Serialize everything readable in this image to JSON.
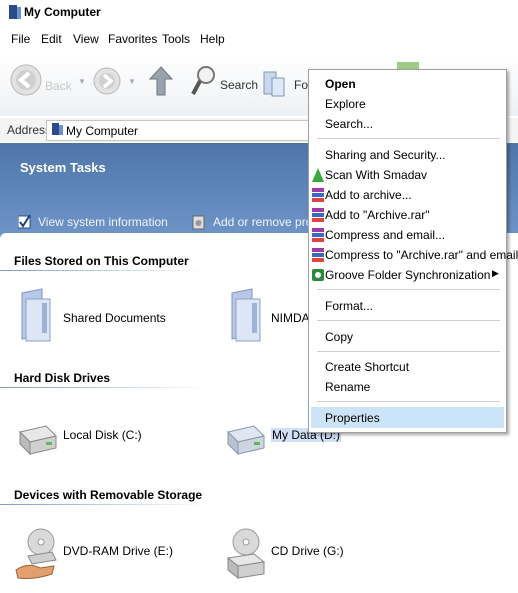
{
  "window": {
    "title": "My Computer"
  },
  "menu": [
    "File",
    "Edit",
    "View",
    "Favorites",
    "Tools",
    "Help"
  ],
  "toolbar": {
    "back": "Back",
    "search": "Search",
    "folders": "Fol"
  },
  "address": {
    "label": "Address",
    "value": "My Computer"
  },
  "task_pane": {
    "header": "System Tasks",
    "view_info": "View system information",
    "add_remove": "Add or remove pro"
  },
  "sections": {
    "files": "Files Stored on This Computer",
    "hdd": "Hard Disk Drives",
    "removable": "Devices with Removable Storage"
  },
  "items": {
    "shared_docs": "Shared Documents",
    "nimda_docs": "NIMDA's",
    "local_disk": "Local Disk (C:)",
    "my_data": "My Data (D:)",
    "dvd": "DVD-RAM Drive (E:)",
    "cd": "CD Drive (G:)"
  },
  "context_menu": {
    "open": "Open",
    "explore": "Explore",
    "search": "Search...",
    "sharing": "Sharing and Security...",
    "scan": "Scan With Smadav",
    "add_archive": "Add to archive...",
    "add_rar": "Add to \"Archive.rar\"",
    "compress_email": "Compress and email...",
    "compress_rar_email": "Compress to \"Archive.rar\" and email",
    "groove": "Groove Folder Synchronization",
    "format": "Format...",
    "copy": "Copy",
    "shortcut": "Create Shortcut",
    "rename": "Rename",
    "properties": "Properties"
  },
  "colors": {
    "task_pane": "#5d84b9",
    "highlight": "#cce4f7",
    "selection": "#cfe0f7"
  }
}
